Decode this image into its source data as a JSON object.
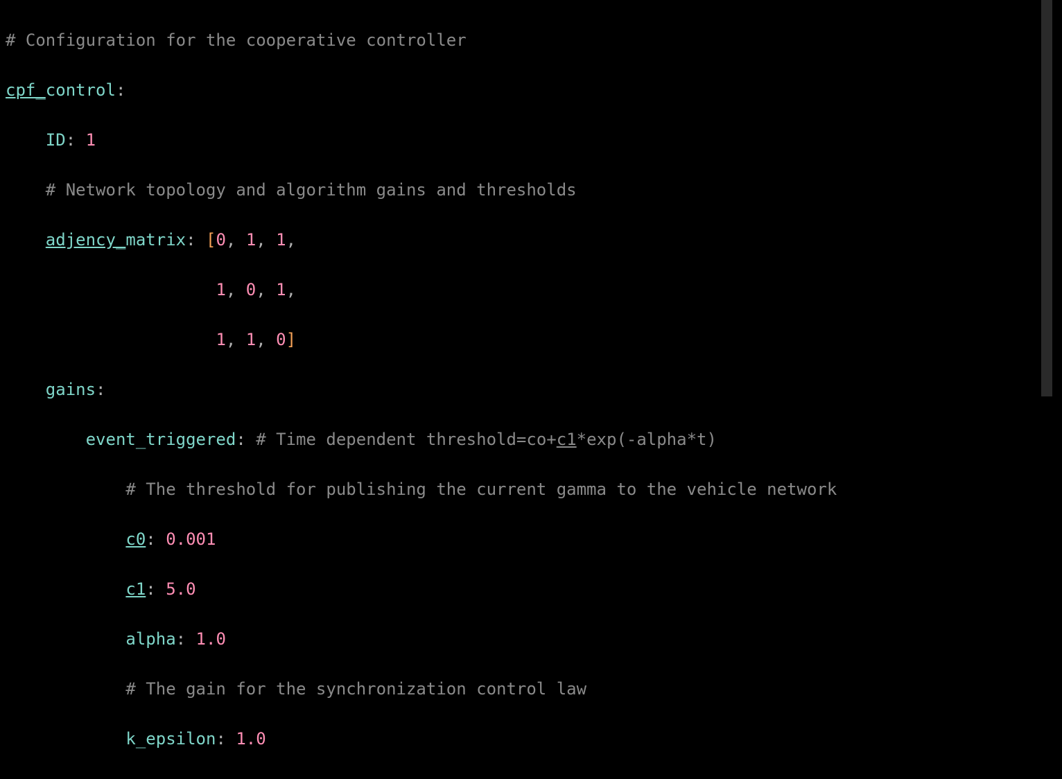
{
  "lines": {
    "l1": {
      "comment": "# Configuration for the cooperative controller"
    },
    "l2": {
      "key1": "cpf_",
      "key2": "control",
      "colon": ":"
    },
    "l3": {
      "indent": "    ",
      "key": "ID",
      "colon": ":",
      "sp": " ",
      "val": "1"
    },
    "l4": {
      "indent": "    ",
      "comment": "# Network topology and algorithm gains and thresholds"
    },
    "l5": {
      "indent": "    ",
      "key1": "adjency_",
      "key2": "matrix",
      "colon": ":",
      "sp": " ",
      "lb": "[",
      "n0": "0",
      "c0": ",",
      "s0": " ",
      "n1": "1",
      "c1": ",",
      "s1": " ",
      "n2": "1",
      "c2": ","
    },
    "l6": {
      "indent": "                     ",
      "n0": "1",
      "c0": ",",
      "s0": " ",
      "n1": "0",
      "c1": ",",
      "s1": " ",
      "n2": "1",
      "c2": ","
    },
    "l7": {
      "indent": "                     ",
      "n0": "1",
      "c0": ",",
      "s0": " ",
      "n1": "1",
      "c1": ",",
      "s1": " ",
      "n2": "0",
      "rb": "]"
    },
    "l8": {
      "indent": "    ",
      "key": "gains",
      "colon": ":"
    },
    "l9": {
      "indent": "        ",
      "key": "event_triggered",
      "colon": ":",
      "sp": " ",
      "cpre": "# Time dependent threshold=co+",
      "cund": "c1",
      "cpost": "*exp(-alpha*t)"
    },
    "l10": {
      "indent": "            ",
      "comment": "# The threshold for publishing the current gamma to the vehicle network"
    },
    "l11": {
      "indent": "            ",
      "key": "c0",
      "colon": ":",
      "sp": " ",
      "val": "0.001"
    },
    "l12": {
      "indent": "            ",
      "key": "c1",
      "colon": ":",
      "sp": " ",
      "val": "5.0"
    },
    "l13": {
      "indent": "            ",
      "key": "alpha",
      "colon": ":",
      "sp": " ",
      "val": "1.0"
    },
    "l14": {
      "indent": "            ",
      "comment": "# The gain for the synchronization control law"
    },
    "l15": {
      "indent": "            ",
      "key": "k_epsilon",
      "colon": ":",
      "sp": " ",
      "val": "1.0"
    }
  }
}
